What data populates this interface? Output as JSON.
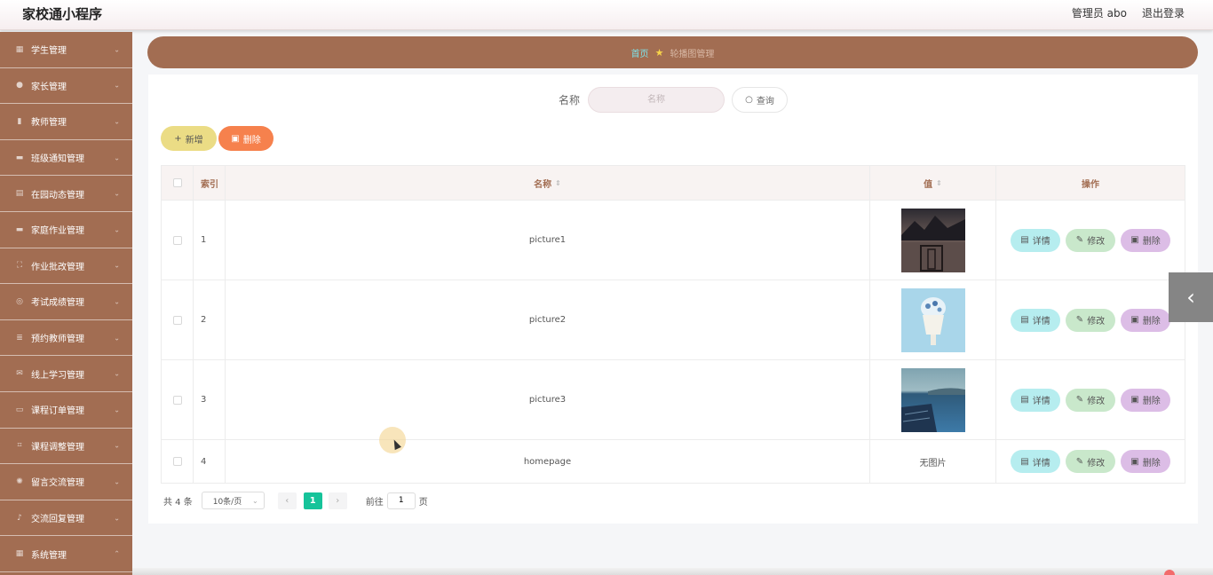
{
  "app": {
    "title": "家校通小程序"
  },
  "topbar": {
    "user_role": "管理员 abo",
    "logout": "退出登录"
  },
  "sidebar": {
    "items": [
      {
        "label": "学生管理",
        "icon": "grid-icon"
      },
      {
        "label": "家长管理",
        "icon": "location-icon"
      },
      {
        "label": "教师管理",
        "icon": "bar-chart-icon"
      },
      {
        "label": "班级通知管理",
        "icon": "monitor-icon"
      },
      {
        "label": "在园动态管理",
        "icon": "briefcase-icon"
      },
      {
        "label": "家庭作业管理",
        "icon": "film-icon"
      },
      {
        "label": "作业批改管理",
        "icon": "fullscreen-icon"
      },
      {
        "label": "考试成绩管理",
        "icon": "compass-icon"
      },
      {
        "label": "预约教师管理",
        "icon": "list-icon"
      },
      {
        "label": "线上学习管理",
        "icon": "mail-icon"
      },
      {
        "label": "课程订单管理",
        "icon": "chat-icon"
      },
      {
        "label": "课程调整管理",
        "icon": "crop-icon"
      },
      {
        "label": "留言交流管理",
        "icon": "aperture-icon"
      },
      {
        "label": "交流回复管理",
        "icon": "mic-icon"
      },
      {
        "label": "系统管理",
        "icon": "calendar-icon"
      }
    ]
  },
  "breadcrumb": {
    "home": "首页",
    "current": "轮播图管理"
  },
  "search": {
    "label": "名称",
    "placeholder": "名称",
    "button": "查询"
  },
  "toolbar": {
    "add": "新增",
    "delete": "删除"
  },
  "table": {
    "headers": {
      "index": "索引",
      "name": "名称",
      "value": "值",
      "ops": "操作"
    },
    "rows": [
      {
        "index": "1",
        "name": "picture1",
        "value_type": "image"
      },
      {
        "index": "2",
        "name": "picture2",
        "value_type": "image"
      },
      {
        "index": "3",
        "name": "picture3",
        "value_type": "image"
      },
      {
        "index": "4",
        "name": "homepage",
        "value_text": "无图片"
      }
    ],
    "ops": {
      "detail": "详情",
      "edit": "修改",
      "remove": "删除"
    }
  },
  "pager": {
    "total": "共 4 条",
    "page_size": "10条/页",
    "current_page": "1",
    "goto_label": "前往",
    "goto_value": "1",
    "page_unit": "页"
  },
  "colors": {
    "brand": "#a26d52",
    "active_page": "#16c39a",
    "add_btn": "#ebdc85",
    "delete_btn": "#f6814d"
  }
}
